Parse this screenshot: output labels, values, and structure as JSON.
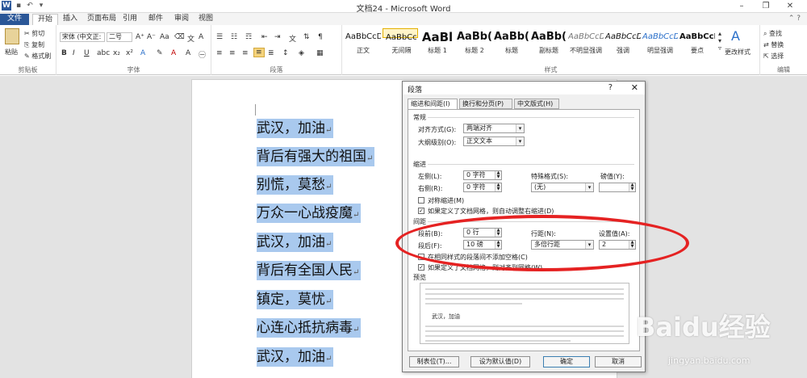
{
  "window": {
    "title": "文档24 - Microsoft Word",
    "logo": "W",
    "controls": [
      "–",
      "❐",
      "✕"
    ]
  },
  "tabs": [
    "文件",
    "开始",
    "插入",
    "页面布局",
    "引用",
    "邮件",
    "审阅",
    "视图"
  ],
  "ribbon": {
    "clipboard": {
      "label": "剪贴板",
      "paste": "粘贴",
      "cut": "剪切",
      "copy": "复制",
      "format_painter": "格式刷"
    },
    "font": {
      "label": "字体",
      "font_name": "宋体 (中文正:",
      "font_size": "二号"
    },
    "paragraph": {
      "label": "段落"
    },
    "styles": {
      "label": "样式",
      "items": [
        {
          "sample": "AaBbCcDd",
          "name": "正文"
        },
        {
          "sample": "AaBbCcDd",
          "name": "无间隔"
        },
        {
          "sample": "AaBl",
          "name": "标题 1"
        },
        {
          "sample": "AaBb(",
          "name": "标题 2"
        },
        {
          "sample": "AaBb(",
          "name": "标题"
        },
        {
          "sample": "AaBb(",
          "name": "副标题"
        },
        {
          "sample": "AaBbCcDd",
          "name": "不明显强调"
        },
        {
          "sample": "AaBbCcDd",
          "name": "强调"
        },
        {
          "sample": "AaBbCcDd",
          "name": "明显强调"
        },
        {
          "sample": "AaBbCcDc",
          "name": "要点"
        }
      ],
      "change_styles": "更改样式"
    },
    "editing": {
      "label": "编辑",
      "find": "查找",
      "replace": "替换",
      "select": "选择"
    }
  },
  "document": {
    "lines": [
      "武汉，加油",
      "背后有强大的祖国",
      "别慌，莫愁",
      "万众一心战疫魔",
      "武汉，加油",
      "背后有全国人民",
      "镇定，莫忧",
      "心连心抵抗病毒",
      "武汉，加油"
    ],
    "para_mark": "↵"
  },
  "dialog": {
    "title": "段落",
    "help": "?",
    "close": "✕",
    "tabs": [
      "缩进和间距(I)",
      "换行和分页(P)",
      "中文版式(H)"
    ],
    "general": {
      "heading": "常规",
      "alignment_label": "对齐方式(G):",
      "alignment_value": "两端对齐",
      "outline_label": "大纲级别(O):",
      "outline_value": "正文文本"
    },
    "indent": {
      "heading": "缩进",
      "left_label": "左侧(L):",
      "left_value": "0 字符",
      "right_label": "右侧(R):",
      "right_value": "0 字符",
      "special_label": "特殊格式(S):",
      "special_value": "(无)",
      "by_label": "磅值(Y):",
      "by_value": "",
      "mirror_label": "对称缩进(M)",
      "grid_label": "如果定义了文档网格，则自动调整右缩进(D)"
    },
    "spacing": {
      "heading": "间距",
      "before_label": "段前(B):",
      "before_value": "0 行",
      "after_label": "段后(F):",
      "after_value": "10 磅",
      "line_label": "行距(N):",
      "line_value": "多倍行距",
      "at_label": "设置值(A):",
      "at_value": "2",
      "no_space_label": "在相同样式的段落间不添加空格(C)",
      "snap_label": "如果定义了文档网格，则对齐到网格(W)"
    },
    "preview": {
      "heading": "预览",
      "sample_text": "武汉，加油"
    },
    "buttons": {
      "tabs": "制表位(T)...",
      "set_default": "设为默认值(D)",
      "ok": "确定",
      "cancel": "取消"
    }
  },
  "watermark": {
    "brand": "Baidu经验",
    "url": "jingyan.baidu.com"
  },
  "colors": {
    "file_tab": "#2b5797",
    "selection": "#a9c9ee",
    "annotation": "#e52222"
  }
}
